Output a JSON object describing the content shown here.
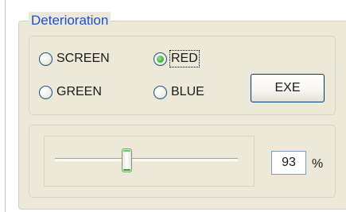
{
  "group": {
    "title": "Deterioration"
  },
  "channel_options": {
    "screen": {
      "label": "SCREEN",
      "checked": false
    },
    "red": {
      "label": "RED",
      "checked": true,
      "focused": true
    },
    "green": {
      "label": "GREEN",
      "checked": false
    },
    "blue": {
      "label": "BLUE",
      "checked": false
    }
  },
  "actions": {
    "exe_label": "EXE"
  },
  "level": {
    "value": "93",
    "unit": "%",
    "slider_fraction": 0.38
  },
  "colors": {
    "group_title": "#1d50c4",
    "panel_background": "#ece9d8",
    "radio_selected": "#4fbb4f",
    "button_border": "#003c74",
    "input_border": "#7f9db9"
  }
}
